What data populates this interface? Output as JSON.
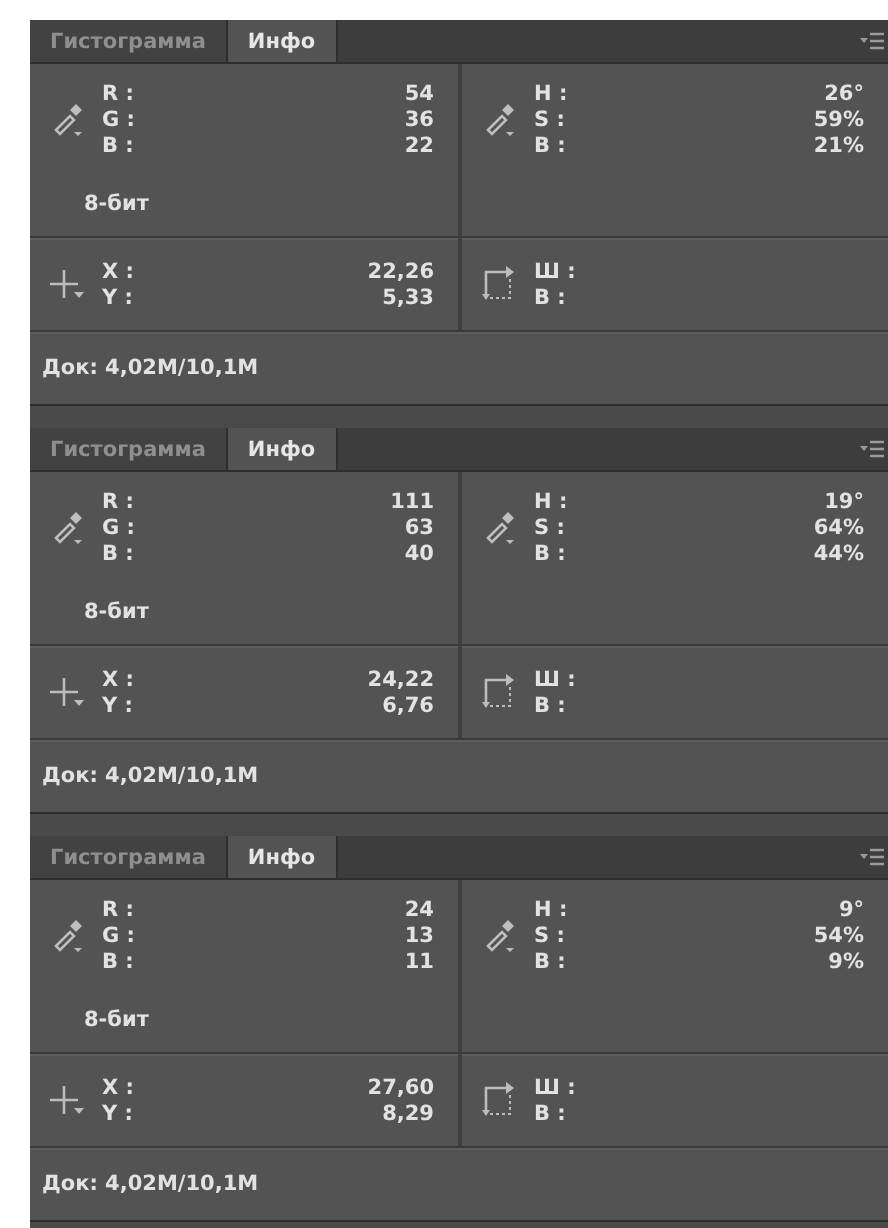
{
  "panels": [
    {
      "tabs": [
        {
          "label": "Гистограмма",
          "selected": false
        },
        {
          "label": "Инфо",
          "selected": true
        }
      ],
      "rgb": [
        {
          "label": "R :",
          "value": "54"
        },
        {
          "label": "G :",
          "value": "36"
        },
        {
          "label": "B :",
          "value": "22"
        }
      ],
      "depth": "8-бит",
      "hsb": [
        {
          "label": "H :",
          "value": "26°"
        },
        {
          "label": "S :",
          "value": "59%"
        },
        {
          "label": "B :",
          "value": "21%"
        }
      ],
      "xy": [
        {
          "label": "X :",
          "value": "22,26"
        },
        {
          "label": "Y :",
          "value": "5,33"
        }
      ],
      "size": [
        {
          "label": "Ш :"
        },
        {
          "label": "В :"
        }
      ],
      "doc": "Док: 4,02M/10,1M"
    },
    {
      "tabs": [
        {
          "label": "Гистограмма",
          "selected": false
        },
        {
          "label": "Инфо",
          "selected": true
        }
      ],
      "rgb": [
        {
          "label": "R :",
          "value": "111"
        },
        {
          "label": "G :",
          "value": "63"
        },
        {
          "label": "B :",
          "value": "40"
        }
      ],
      "depth": "8-бит",
      "hsb": [
        {
          "label": "H :",
          "value": "19°"
        },
        {
          "label": "S :",
          "value": "64%"
        },
        {
          "label": "B :",
          "value": "44%"
        }
      ],
      "xy": [
        {
          "label": "X :",
          "value": "24,22"
        },
        {
          "label": "Y :",
          "value": "6,76"
        }
      ],
      "size": [
        {
          "label": "Ш :"
        },
        {
          "label": "В :"
        }
      ],
      "doc": "Док: 4,02M/10,1M"
    },
    {
      "tabs": [
        {
          "label": "Гистограмма",
          "selected": false
        },
        {
          "label": "Инфо",
          "selected": true
        }
      ],
      "rgb": [
        {
          "label": "R :",
          "value": "24"
        },
        {
          "label": "G :",
          "value": "13"
        },
        {
          "label": "B :",
          "value": "11"
        }
      ],
      "depth": "8-бит",
      "hsb": [
        {
          "label": "H :",
          "value": "9°"
        },
        {
          "label": "S :",
          "value": "54%"
        },
        {
          "label": "B :",
          "value": "9%"
        }
      ],
      "xy": [
        {
          "label": "X :",
          "value": "27,60"
        },
        {
          "label": "Y :",
          "value": "8,29"
        }
      ],
      "size": [
        {
          "label": "Ш :"
        },
        {
          "label": "В :"
        }
      ],
      "doc": "Док: 4,02M/10,1M"
    }
  ]
}
